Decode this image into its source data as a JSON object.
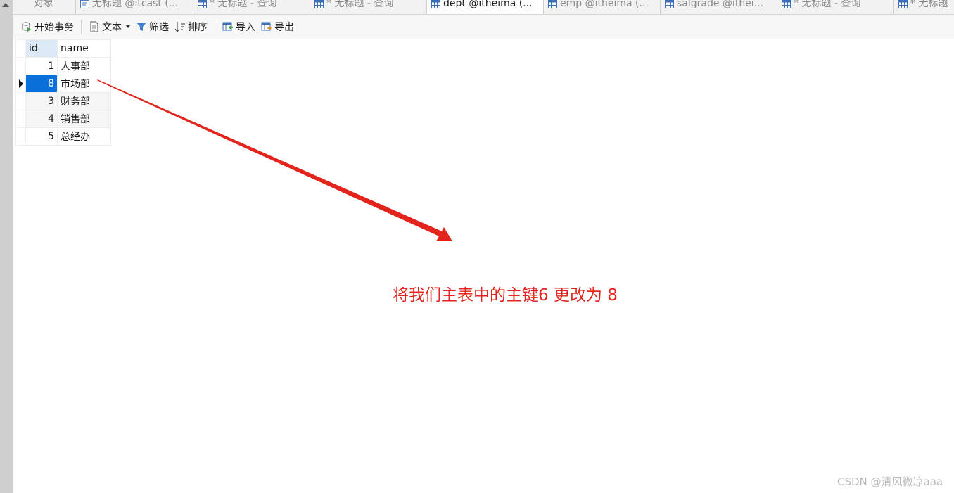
{
  "tabs": [
    {
      "label": "对象",
      "icon": "none",
      "active": false
    },
    {
      "label": "无标题 @itcast (...",
      "icon": "query-icon",
      "active": false
    },
    {
      "label": "* 无标题 - 查询",
      "icon": "table-icon",
      "active": false
    },
    {
      "label": "* 无标题 - 查询",
      "icon": "table-icon",
      "active": false
    },
    {
      "label": "dept @itheima (...",
      "icon": "table-icon",
      "active": true
    },
    {
      "label": "emp @itheima (...",
      "icon": "table-icon",
      "active": false
    },
    {
      "label": "salgrade @ithei...",
      "icon": "table-icon",
      "active": false
    },
    {
      "label": "* 无标题 - 查询",
      "icon": "table-icon",
      "active": false
    },
    {
      "label": "* 无标题",
      "icon": "table-icon",
      "active": false
    }
  ],
  "toolbar": {
    "begin_transaction": "开始事务",
    "text": "文本",
    "filter": "筛选",
    "sort": "排序",
    "import": "导入",
    "export": "导出"
  },
  "grid": {
    "columns": [
      "id",
      "name"
    ],
    "rows": [
      {
        "id": "1",
        "name": "人事部"
      },
      {
        "id": "8",
        "name": "市场部"
      },
      {
        "id": "3",
        "name": "财务部"
      },
      {
        "id": "4",
        "name": "销售部"
      },
      {
        "id": "5",
        "name": "总经办"
      }
    ],
    "selected_row": 1
  },
  "annotation": {
    "text": "将我们主表中的主键6 更改为 8",
    "color": "#e3241c"
  },
  "watermark": "CSDN @清风微凉aaa",
  "colors": {
    "selection": "#0a6fd8",
    "header_highlight": "#dbe9f6"
  }
}
